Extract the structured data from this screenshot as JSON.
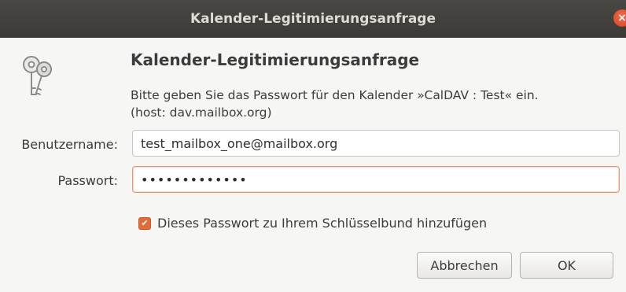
{
  "window": {
    "title": "Kalender-Legitimierungsanfrage",
    "close_symbol": "×"
  },
  "dialog": {
    "heading": "Kalender-Legitimierungsanfrage",
    "description_line1": "Bitte geben Sie das Passwort für den Kalender »CalDAV : Test« ein.",
    "description_line2": "(host: dav.mailbox.org)",
    "icon": "keys-icon"
  },
  "form": {
    "username_label": "Benutzername:",
    "username_value": "test_mailbox_one@mailbox.org",
    "password_label": "Passwort:",
    "password_value": "•••••••••••••",
    "remember_label": "Dieses Passwort zu Ihrem Schlüsselbund hinzufügen",
    "remember_checked": true
  },
  "buttons": {
    "cancel_label": "Abbrechen",
    "ok_label": "OK"
  },
  "colors": {
    "titlebar": "#3b3a36",
    "accent": "#e26b37",
    "focus_border": "#e9956f"
  }
}
